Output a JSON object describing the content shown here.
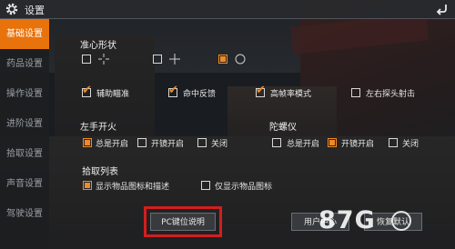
{
  "header": {
    "title": "设置",
    "gear_icon": "gear-icon",
    "back_icon": "back-arrow-icon"
  },
  "sidebar": {
    "items": [
      {
        "label": "基础设置",
        "active": true
      },
      {
        "label": "药品设置",
        "active": false
      },
      {
        "label": "操作设置",
        "active": false
      },
      {
        "label": "进阶设置",
        "active": false
      },
      {
        "label": "拾取设置",
        "active": false
      },
      {
        "label": "声音设置",
        "active": false
      },
      {
        "label": "驾驶设置",
        "active": false
      }
    ]
  },
  "crosshair": {
    "title": "准心形状",
    "options": [
      {
        "icon": "crosshair-plus-gap-icon",
        "checked": false
      },
      {
        "icon": "crosshair-plus-icon",
        "checked": false
      },
      {
        "icon": "crosshair-circle-icon",
        "checked": true
      }
    ]
  },
  "toggles": [
    {
      "label": "辅助瞄准",
      "checked": true
    },
    {
      "label": "命中反馈",
      "checked": true
    },
    {
      "label": "高帧率模式",
      "checked": true
    },
    {
      "label": "左右探头射击",
      "checked": false
    }
  ],
  "left_hand_fire": {
    "title": "左手开火",
    "options": [
      {
        "label": "总是开启",
        "checked": true
      },
      {
        "label": "开镜开启",
        "checked": false
      },
      {
        "label": "关闭",
        "checked": false
      }
    ]
  },
  "gyroscope": {
    "title": "陀螺仪",
    "options": [
      {
        "label": "总是开启",
        "checked": false
      },
      {
        "label": "开镜开启",
        "checked": true
      },
      {
        "label": "关闭",
        "checked": false
      }
    ]
  },
  "pickup_list": {
    "title": "拾取列表",
    "options": [
      {
        "label": "显示物品图标和描述",
        "checked": true
      },
      {
        "label": "仅显示物品图标",
        "checked": false
      }
    ]
  },
  "buttons": {
    "pc_keys": "PC键位说明",
    "user_center": "用户中心",
    "restore_default": "恢复默认"
  },
  "watermark": {
    "text": "87G",
    "suffix": ".com"
  },
  "colors": {
    "accent": "#e8720c",
    "check": "#f08a24",
    "highlight": "#d21e1e"
  }
}
